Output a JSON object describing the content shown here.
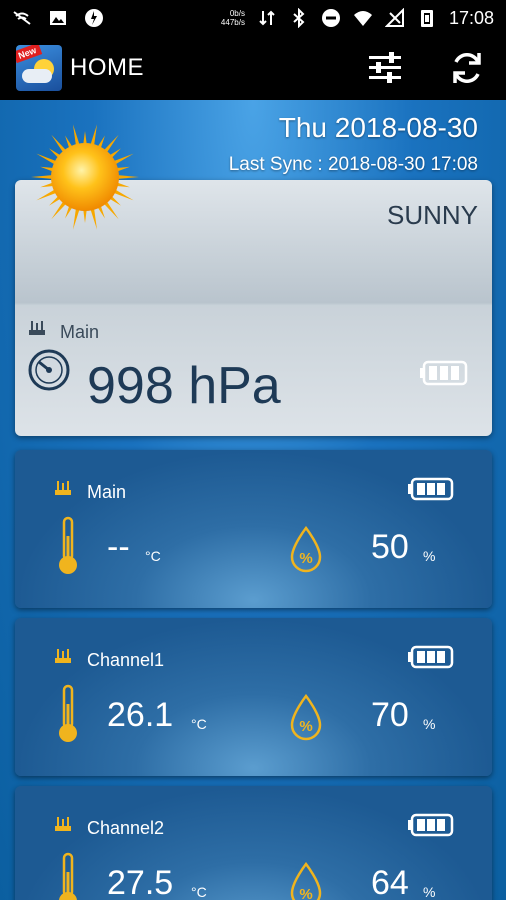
{
  "status_bar": {
    "net_speed_up": "0b/s",
    "net_speed_down": "447b/s",
    "clock": "17:08"
  },
  "app_bar": {
    "logo_badge": "New",
    "title": "HOME"
  },
  "header": {
    "date": "Thu 2018-08-30",
    "last_sync": "Last Sync : 2018-08-30 17:08"
  },
  "pressure": {
    "condition": "SUNNY",
    "station": "Main",
    "value": "998 hPa"
  },
  "sensors": [
    {
      "name": "Main",
      "temperature": "--",
      "temp_unit": "°C",
      "humidity": "50",
      "humidity_unit": "%"
    },
    {
      "name": "Channel1",
      "temperature": "26.1",
      "temp_unit": "°C",
      "humidity": "70",
      "humidity_unit": "%"
    },
    {
      "name": "Channel2",
      "temperature": "27.5",
      "temp_unit": "°C",
      "humidity": "64",
      "humidity_unit": "%"
    }
  ],
  "colors": {
    "accent_gold": "#f0b41e",
    "background_blue": "#0b5fa0",
    "card_blue": "#1d5a93"
  }
}
